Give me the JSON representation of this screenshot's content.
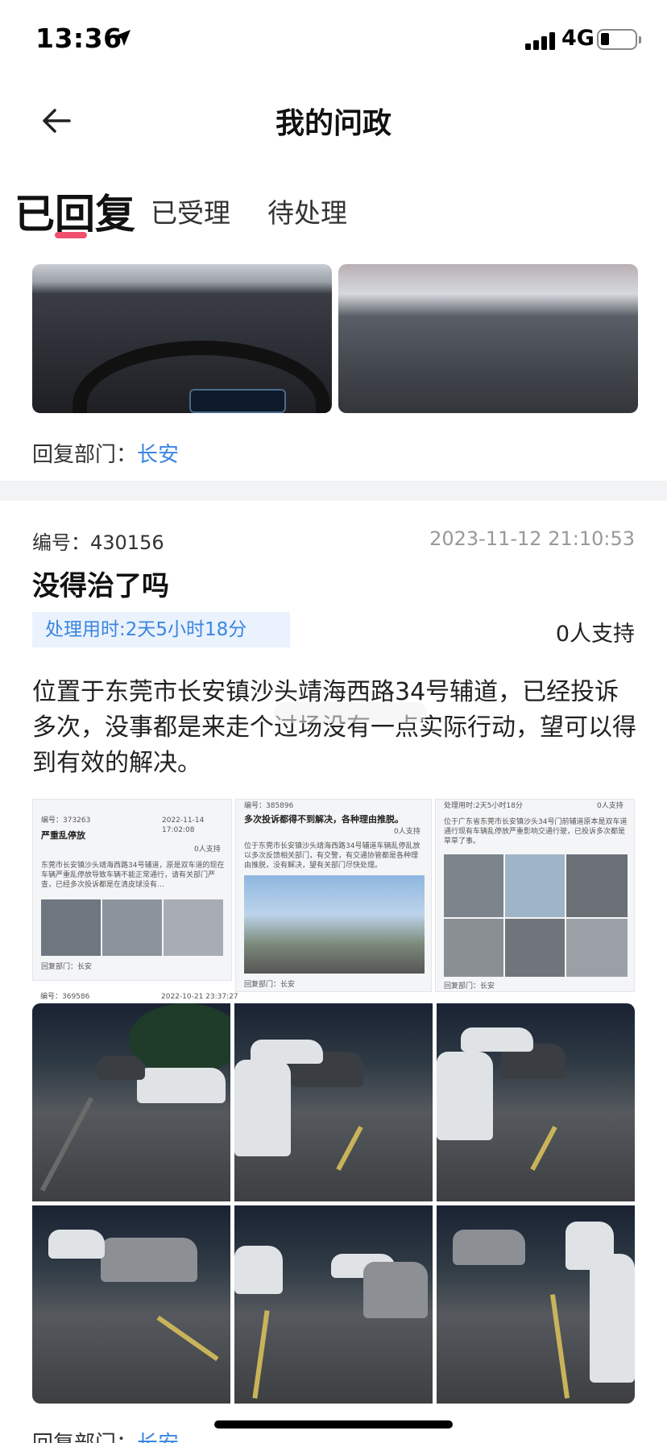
{
  "status_bar": {
    "time": "13:36",
    "network": "4G"
  },
  "nav": {
    "title": "我的问政"
  },
  "tabs": [
    {
      "label": "已回复",
      "active": true
    },
    {
      "label": "已受理",
      "active": false
    },
    {
      "label": "待处理",
      "active": false
    }
  ],
  "reply_dept_label": "回复部门：",
  "first_item": {
    "dept": "长安"
  },
  "card": {
    "id_label": "编号：",
    "id": "430156",
    "time": "2023-11-12 21:10:53",
    "title": "没得治了吗",
    "duration": "处理用时:2天5小时18分",
    "support": "0人支持",
    "body": "位置于东莞市长安镇沙头靖海西路34号辅道，已经投诉多次，没事都是来走个过场没有一点实际行动，望可以得到有效的解决。",
    "dept": "长安"
  },
  "embedded": {
    "a": {
      "id": "编号：373263",
      "time": "2022-11-14 17:02:08",
      "title": "严重乱停放",
      "support": "0人支持",
      "body": "东莞市长安镇沙头靖海西路34号辅道，原是双车道的现在车辆严重乱停放导致车辆不能正常通行，请有关部门严查，已经多次投诉都是在清皮球没有…",
      "dept": "回复部门：长安"
    },
    "b": {
      "id": "编号：385896",
      "title": "多次投诉都得不到解决，各种理由推脱。",
      "support": "0人支持",
      "body": "位于东莞市长安镇沙头靖海西路34号辅道车辆乱停乱放以多次反馈相关部门，有交警，有交通协管都是各种理由推脱，没有解决，望有关部门尽快处理。",
      "dept": "回复部门：长安"
    },
    "c": {
      "title": "处理用时:2天5小时18分",
      "support": "0人支持",
      "body": "位于广东省东莞市长安镇沙头34号门前辅道原本是双车道通行现有车辆乱停放严重影响交通行驶，已投诉多次都是草草了事。",
      "dept": "回复部门：长安"
    },
    "d": {
      "id": "编号：369586",
      "time": "2022-10-21 23:37:27"
    }
  }
}
